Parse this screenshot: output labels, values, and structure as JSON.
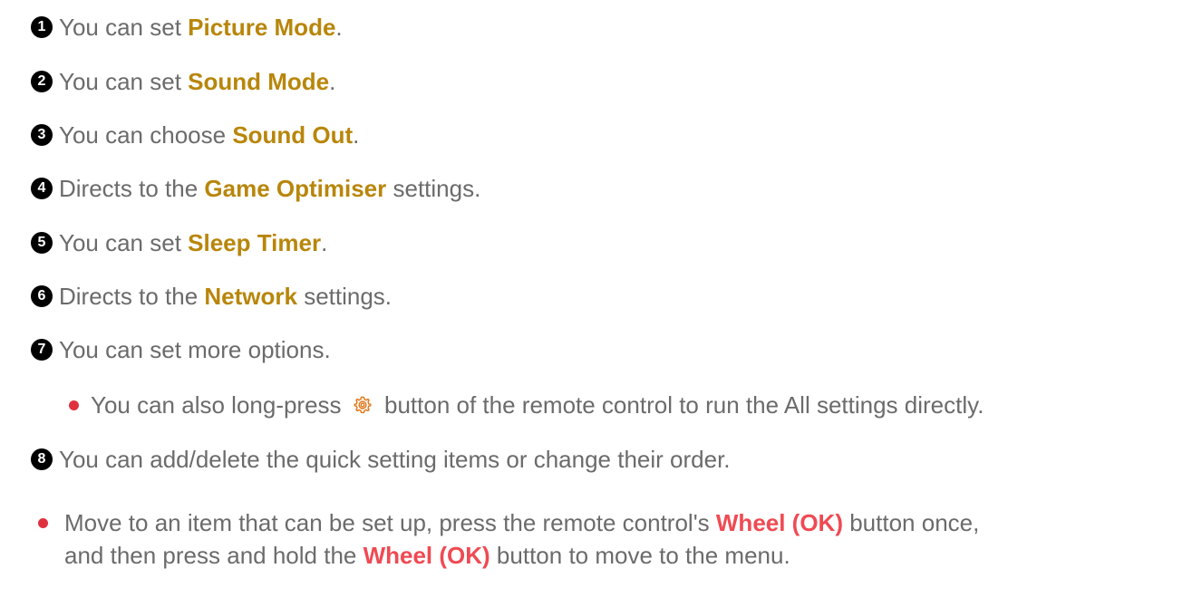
{
  "items": [
    {
      "num": "1",
      "pre": "You can set ",
      "bold": "Picture Mode",
      "post": "."
    },
    {
      "num": "2",
      "pre": "You can set ",
      "bold": "Sound Mode",
      "post": "."
    },
    {
      "num": "3",
      "pre": "You can choose ",
      "bold": "Sound Out",
      "post": "."
    },
    {
      "num": "4",
      "pre": "Directs to the ",
      "bold": "Game Optimiser",
      "post": " settings."
    },
    {
      "num": "5",
      "pre": "You can set ",
      "bold": "Sleep Timer",
      "post": "."
    },
    {
      "num": "6",
      "pre": "Directs to the ",
      "bold": "Network",
      "post": " settings."
    },
    {
      "num": "7",
      "text": "You can set more options."
    },
    {
      "num": "8",
      "text": "You can add/delete the quick setting items or change their order."
    }
  ],
  "sub_bullet": {
    "pre": "You can also long-press ",
    "icon": "settings-gear-icon",
    "post": " button of the remote control to run the All settings directly."
  },
  "note": {
    "p1": "Move to an item that can be set up, press the remote control's ",
    "b1": "Wheel (OK)",
    "p2": " button once,",
    "p3": "and then press and hold the ",
    "b2": "Wheel (OK)",
    "p4": " button to move to the menu."
  },
  "colors": {
    "text": "#6b6b6b",
    "highlight": "#b8860b",
    "remote_button": "#f04a53",
    "bullet": "#e0303f"
  }
}
